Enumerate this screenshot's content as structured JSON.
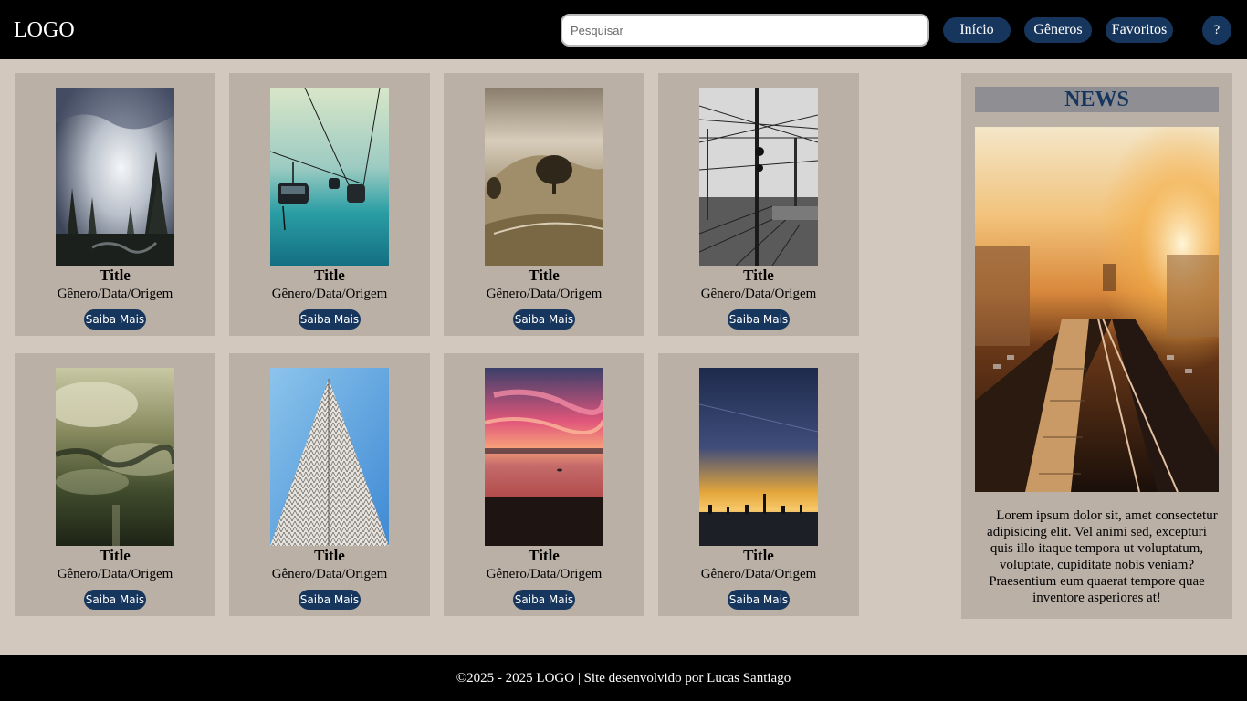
{
  "header": {
    "logo": "LOGO",
    "search_placeholder": "Pesquisar",
    "nav": [
      "Início",
      "Gêneros",
      "Favoritos"
    ],
    "help": "?"
  },
  "cards": [
    {
      "title": "Title",
      "meta": "Gênero/Data/Origem",
      "button": "Saiba Mais",
      "image": "misty-forest"
    },
    {
      "title": "Title",
      "meta": "Gênero/Data/Origem",
      "button": "Saiba Mais",
      "image": "cable-cars"
    },
    {
      "title": "Title",
      "meta": "Gênero/Data/Origem",
      "button": "Saiba Mais",
      "image": "sepia-hill-tree"
    },
    {
      "title": "Title",
      "meta": "Gênero/Data/Origem",
      "button": "Saiba Mais",
      "image": "railway-wires"
    },
    {
      "title": "Title",
      "meta": "Gênero/Data/Origem",
      "button": "Saiba Mais",
      "image": "foggy-valley"
    },
    {
      "title": "Title",
      "meta": "Gênero/Data/Origem",
      "button": "Saiba Mais",
      "image": "skyscraper"
    },
    {
      "title": "Title",
      "meta": "Gênero/Data/Origem",
      "button": "Saiba Mais",
      "image": "pink-beach-sunset"
    },
    {
      "title": "Title",
      "meta": "Gênero/Data/Origem",
      "button": "Saiba Mais",
      "image": "dusk-pier"
    }
  ],
  "news": {
    "title": "NEWS",
    "image": "city-train-sunset",
    "text": "Lorem ipsum dolor sit, amet consectetur adipisicing elit. Vel animi sed, excepturi quis illo itaque tempora ut voluptatum, voluptate, cupiditate nobis veniam? Praesentium eum quaerat tempore quae inventore asperiores at!"
  },
  "footer": {
    "text": "©2025 - 2025 LOGO | Site desenvolvido por Lucas Santiago"
  },
  "colors": {
    "header_bg": "#000000",
    "page_bg": "#d3c8be",
    "card_bg": "#bbb0a6",
    "accent": "#17365e",
    "news_title_bg": "#8f8f93"
  }
}
